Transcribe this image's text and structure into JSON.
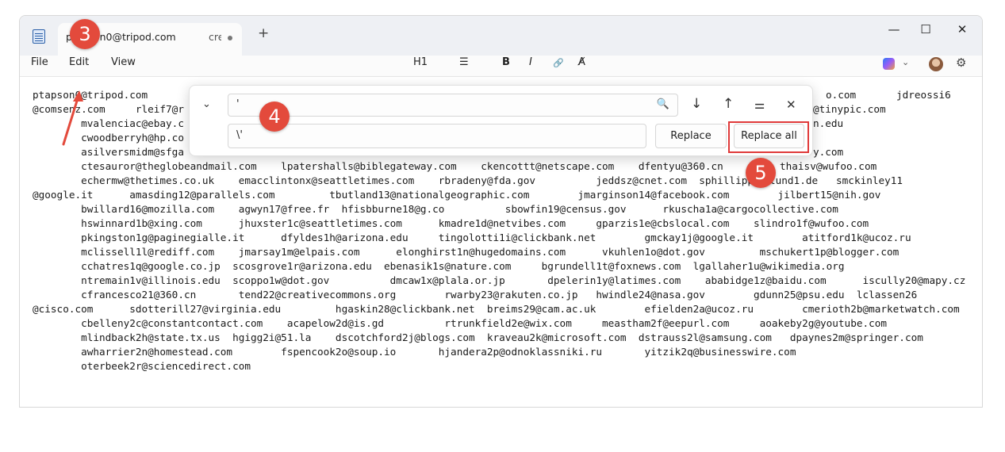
{
  "window": {
    "tab_title": "ptapson0@tripod.com",
    "tab_title_2": "cre",
    "new_tab": "+",
    "minimize": "—",
    "maximize": "☐",
    "close": "✕"
  },
  "menu": {
    "file": "File",
    "edit": "Edit",
    "view": "View"
  },
  "toolbar": {
    "heading": "H1",
    "list": "☰",
    "bold": "B",
    "italic": "I",
    "link": "🔗",
    "clear_format": "A̸"
  },
  "find_replace": {
    "find_value": "'",
    "replace_value": "\\'",
    "replace_label": "Replace",
    "replace_all_label": "Replace all"
  },
  "annotations": {
    "step3": "3",
    "step4": "4",
    "step5": "5"
  },
  "document": {
    "text": "ptapson0@tripod.com\n@comsenz.com     rleif7@r\n        mvalenciac@ebay.c\n        cwoodberryh@hp.co\n        asilversmidm@sfga\n        ctesauror@theglobeandmail.com    lpatershalls@biblegateway.com    ckencottt@netscape.com    dfentyu@360.cn\n        echermw@thetimes.co.uk    emacclintonx@seattletimes.com    rbradeny@fda.gov          jeddsz@cnet.com  sphillipp\n@google.it      amasding12@parallels.com         tbutland13@nationalgeographic.com        jmarginson14@facebook.com        jilbert15@nih.gov\n        bwillard16@mozilla.com    agwyn17@free.fr  hfisbburne18@g.co          sbowfin19@census.gov      rkuscha1a@cargocollective.com\n        hswinnard1b@xing.com      jhuxster1c@seattletimes.com      kmadre1d@netvibes.com     gparzis1e@cbslocal.com    slindro1f@wufoo.com\n        pkingston1g@paginegialle.it      dfyldes1h@arizona.edu     tingolotti1i@clickbank.net        gmckay1j@google.it        atitford1k@ucoz.ru\n        mclissell1l@rediff.com    jmarsay1m@elpais.com      elonghirst1n@hugedomains.com      vkuhlen1o@dot.gov         mschukert1p@blogger.com\n        cchatres1q@google.co.jp  scosgrove1r@arizona.edu  ebenasik1s@nature.com     bgrundell1t@foxnews.com  lgallaher1u@wikimedia.org\n        ntremain1v@illinois.edu  scoppo1w@dot.gov          dmcaw1x@plala.or.jp       dpelerin1y@latimes.com    ababidge1z@baidu.com      iscully20@mapy.cz\n        cfrancesco21@360.cn       tend22@creativecommons.org        rwarby23@rakuten.co.jp   hwindle24@nasa.gov        gdunn25@psu.edu  lclassen26\n@cisco.com      sdotterill27@virginia.edu         hgaskin28@clickbank.net  breims29@cam.ac.uk        efielden2a@ucoz.ru        cmerioth2b@marketwatch.com\n        cbelleny2c@constantcontact.com    acapelow2d@is.gd          rtrunkfield2e@wix.com     meastham2f@eepurl.com     aoakeby2g@youtube.com\n        mlindback2h@state.tx.us  hgigg2i@51.la    dscotchford2j@blogs.com  kraveau2k@microsoft.com  dstrauss2l@samsung.com   dpaynes2m@springer.com\n        awharrier2n@homestead.com        fspencook2o@soup.io       hjandera2p@odnoklassniki.ru       yitzik2q@businesswire.com\n        oterbeek2r@sciencedirect.com"
  },
  "visible_fragments": {
    "r1_mid": "o.com",
    "r1_right": "jdreossi6",
    "r2_right": "@tinypic.com",
    "r3_right": "n.edu",
    "r5_right": "y.com",
    "r6_right": "thaisv@wufoo.com",
    "r7_right": "lund1.de   smckinley11"
  },
  "colors": {
    "accent_red": "#e34a3c",
    "titlebar_bg": "#eef0f4"
  }
}
